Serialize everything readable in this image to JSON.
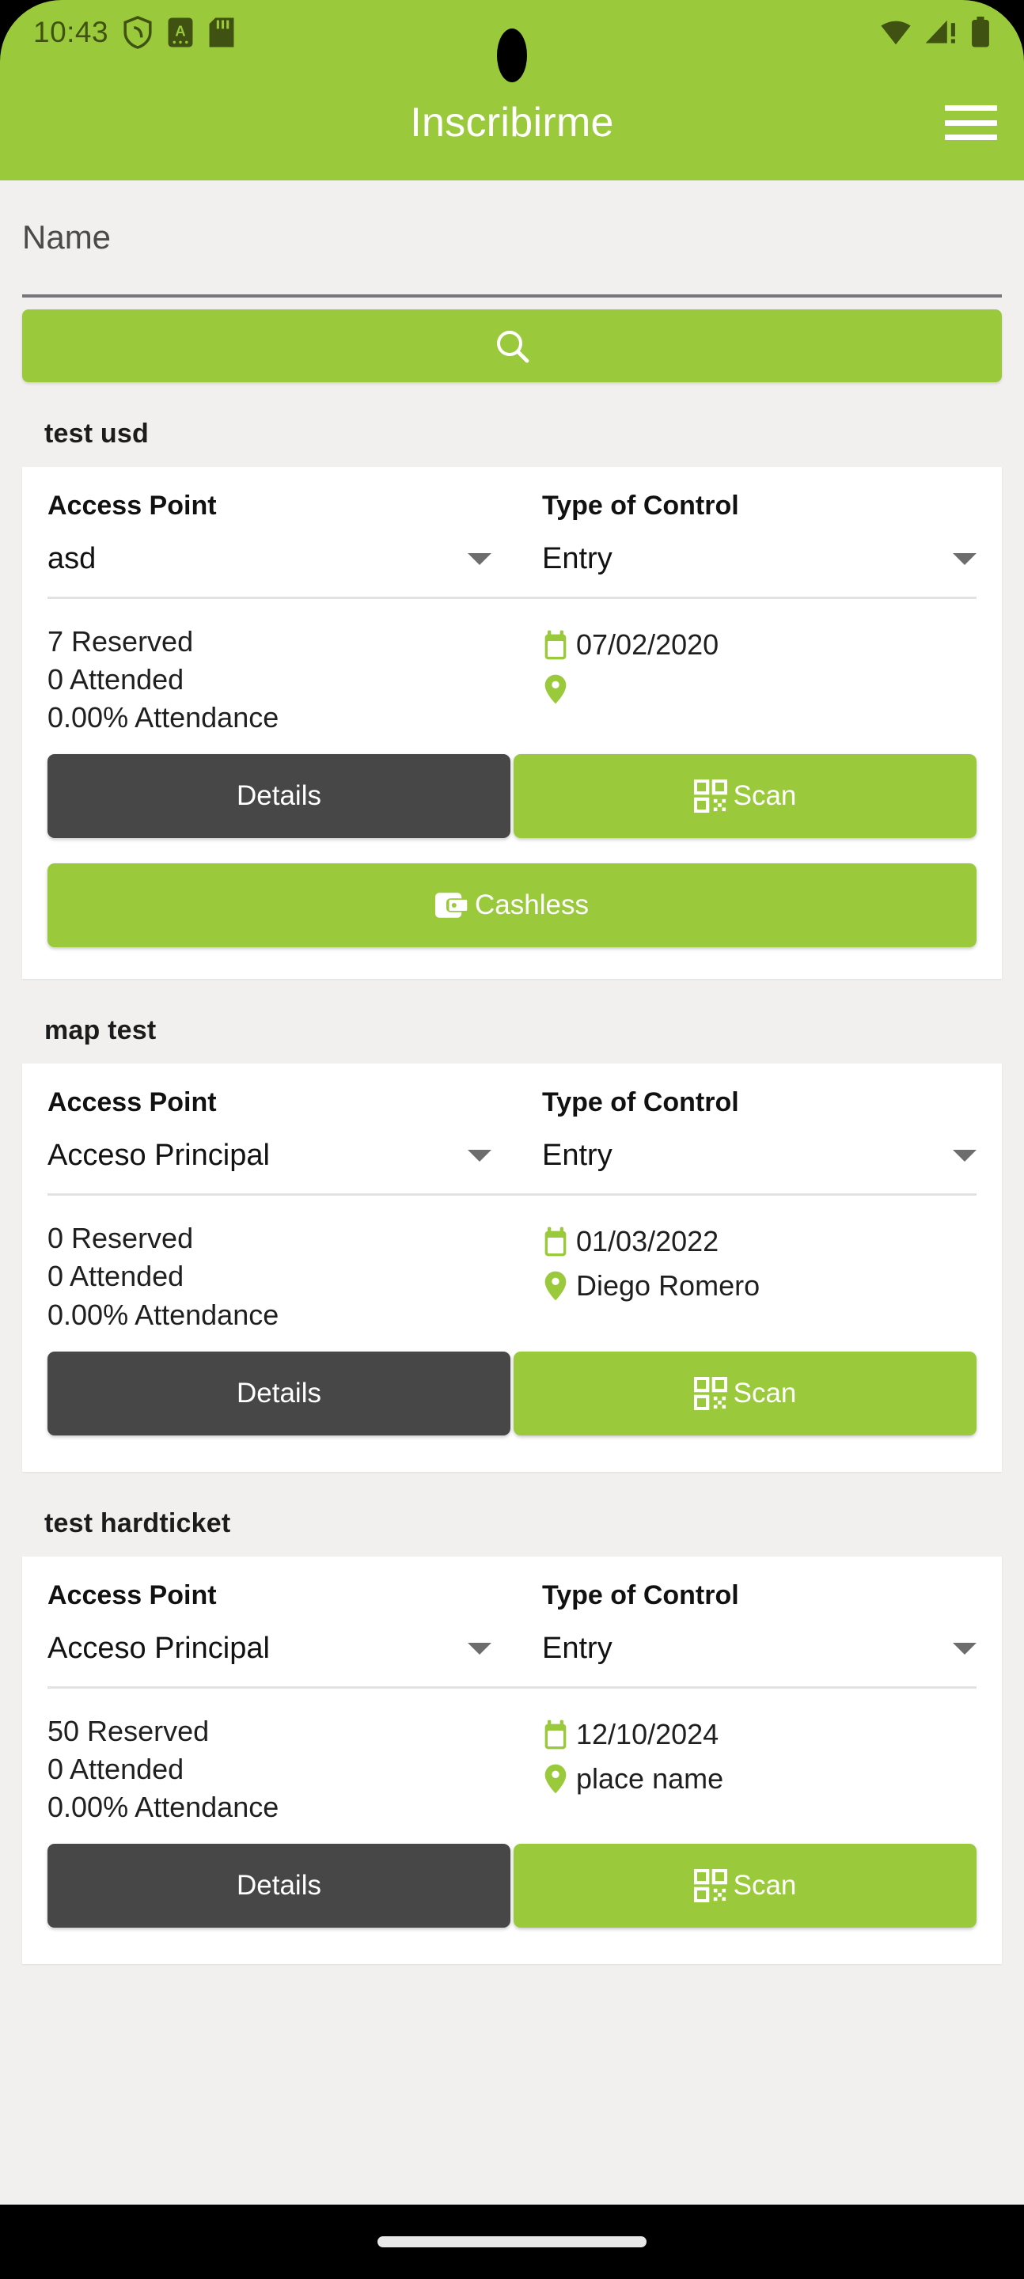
{
  "status_bar": {
    "time": "10:43",
    "left_icons": [
      "shield-icon",
      "a-badge-icon",
      "sd-card-icon"
    ],
    "right_icons": [
      "wifi-icon",
      "cellular-signal-icon",
      "battery-icon"
    ],
    "background_color": "#9ACA3C",
    "icon_color": "#3f5212"
  },
  "app_bar": {
    "title": "Inscribirme",
    "menu_icon": "hamburger-menu-icon",
    "background_color": "#9ACA3C",
    "title_color": "#ffffff"
  },
  "search": {
    "name_value": "",
    "name_placeholder": "Name",
    "button_icon": "search-icon",
    "button_label": ""
  },
  "labels": {
    "access_point": "Access Point",
    "type_of_control": "Type of Control",
    "reserved_suffix": "Reserved",
    "attended_suffix": "Attended",
    "attendance_suffix": "Attendance"
  },
  "buttons": {
    "details": "Details",
    "scan": "Scan",
    "cashless": "Cashless",
    "scan_icon": "qr-code-icon",
    "cashless_icon": "wallet-icon",
    "details_color": "#474747",
    "green_color": "#9ACA3C"
  },
  "events": [
    {
      "title": "test usd",
      "access_point_label": "Access Point",
      "access_point_value": "asd",
      "type_of_control_label": "Type of Control",
      "type_of_control_value": "Entry",
      "reserved": "7 Reserved",
      "attended": "0 Attended",
      "attendance": "0.00% Attendance",
      "date": "07/02/2020",
      "place": "",
      "date_icon": "calendar-icon",
      "place_icon": "location-pin-icon",
      "has_cashless": true
    },
    {
      "title": "map test",
      "access_point_label": "Access Point",
      "access_point_value": "Acceso Principal",
      "type_of_control_label": "Type of Control",
      "type_of_control_value": "Entry",
      "reserved": "0 Reserved",
      "attended": "0 Attended",
      "attendance": "0.00% Attendance",
      "date": "01/03/2022",
      "place": "Diego Romero",
      "date_icon": "calendar-icon",
      "place_icon": "location-pin-icon",
      "has_cashless": false
    },
    {
      "title": "test hardticket",
      "access_point_label": "Access Point",
      "access_point_value": "Acceso Principal",
      "type_of_control_label": "Type of Control",
      "type_of_control_value": "Entry",
      "reserved": "50 Reserved",
      "attended": "0 Attended",
      "attendance": "0.00% Attendance",
      "date": "12/10/2024",
      "place": "place name",
      "date_icon": "calendar-icon",
      "place_icon": "location-pin-icon",
      "has_cashless": false
    }
  ],
  "nav_bar": {
    "home_indicator": "home-indicator-pill"
  }
}
